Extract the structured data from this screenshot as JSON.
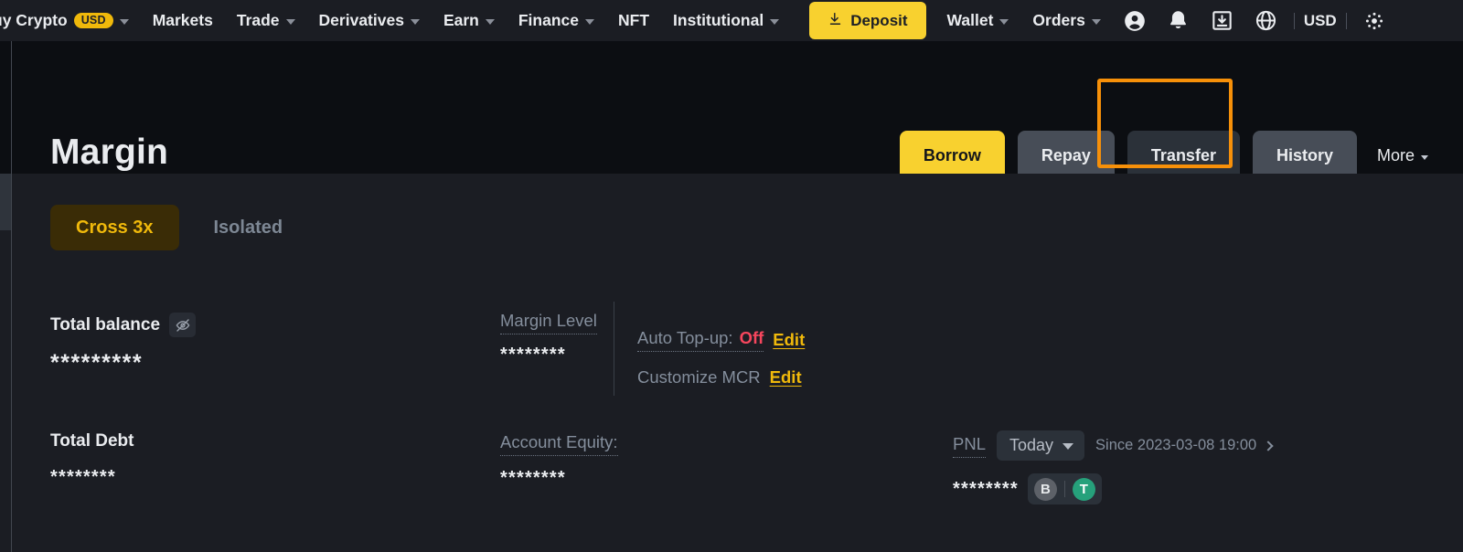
{
  "nav": {
    "items": [
      {
        "label": "uy Crypto",
        "badge": "USD",
        "caret": true,
        "name": "buy-crypto"
      },
      {
        "label": "Markets",
        "caret": false,
        "name": "markets"
      },
      {
        "label": "Trade",
        "caret": true,
        "name": "trade"
      },
      {
        "label": "Derivatives",
        "caret": true,
        "name": "derivatives"
      },
      {
        "label": "Earn",
        "caret": true,
        "name": "earn"
      },
      {
        "label": "Finance",
        "caret": true,
        "name": "finance"
      },
      {
        "label": "NFT",
        "caret": false,
        "name": "nft"
      },
      {
        "label": "Institutional",
        "caret": true,
        "name": "institutional"
      }
    ],
    "deposit_label": "Deposit",
    "right_items": [
      {
        "label": "Wallet",
        "caret": true,
        "name": "wallet"
      },
      {
        "label": "Orders",
        "caret": true,
        "name": "orders"
      }
    ],
    "icons": [
      "user-account-icon",
      "notification-bell-icon",
      "download-box-icon",
      "globe-language-icon"
    ],
    "currency": "USD"
  },
  "header": {
    "title": "Margin",
    "buttons": [
      {
        "label": "Borrow",
        "style": "primary",
        "name": "borrow-button"
      },
      {
        "label": "Repay",
        "style": "ghost",
        "name": "repay-button"
      },
      {
        "label": "Transfer",
        "style": "dim",
        "name": "transfer-button"
      },
      {
        "label": "History",
        "style": "ghost",
        "name": "history-button"
      }
    ],
    "more_label": "More",
    "highlight_color": "#f79009"
  },
  "tabs": [
    {
      "label": "Cross 3x",
      "active": true,
      "name": "tab-cross"
    },
    {
      "label": "Isolated",
      "active": false,
      "name": "tab-isolated"
    }
  ],
  "stats": {
    "total_balance_label": "Total balance",
    "total_balance_value": "*********",
    "total_debt_label": "Total Debt",
    "total_debt_value": "********",
    "margin_level_label": "Margin Level",
    "margin_level_value": "********",
    "account_equity_label": "Account Equity:",
    "account_equity_value": "********"
  },
  "settings": {
    "auto_topup_label": "Auto Top-up:",
    "auto_topup_value": "Off",
    "auto_topup_edit": "Edit",
    "customize_mcr_label": "Customize MCR",
    "customize_mcr_edit": "Edit"
  },
  "pnl": {
    "label": "PNL",
    "period": "Today",
    "since": "Since 2023-03-08 19:00",
    "value": "********",
    "coins": [
      {
        "symbol": "B",
        "name": "btc-coin-icon",
        "active": false
      },
      {
        "symbol": "T",
        "name": "usdt-coin-icon",
        "active": true
      }
    ]
  },
  "colors": {
    "accent_yellow": "#f0b90b",
    "deposit_yellow": "#f8d12f",
    "danger_red": "#f6465d",
    "usdt_green": "#26a17b",
    "highlight_orange": "#f79009"
  }
}
